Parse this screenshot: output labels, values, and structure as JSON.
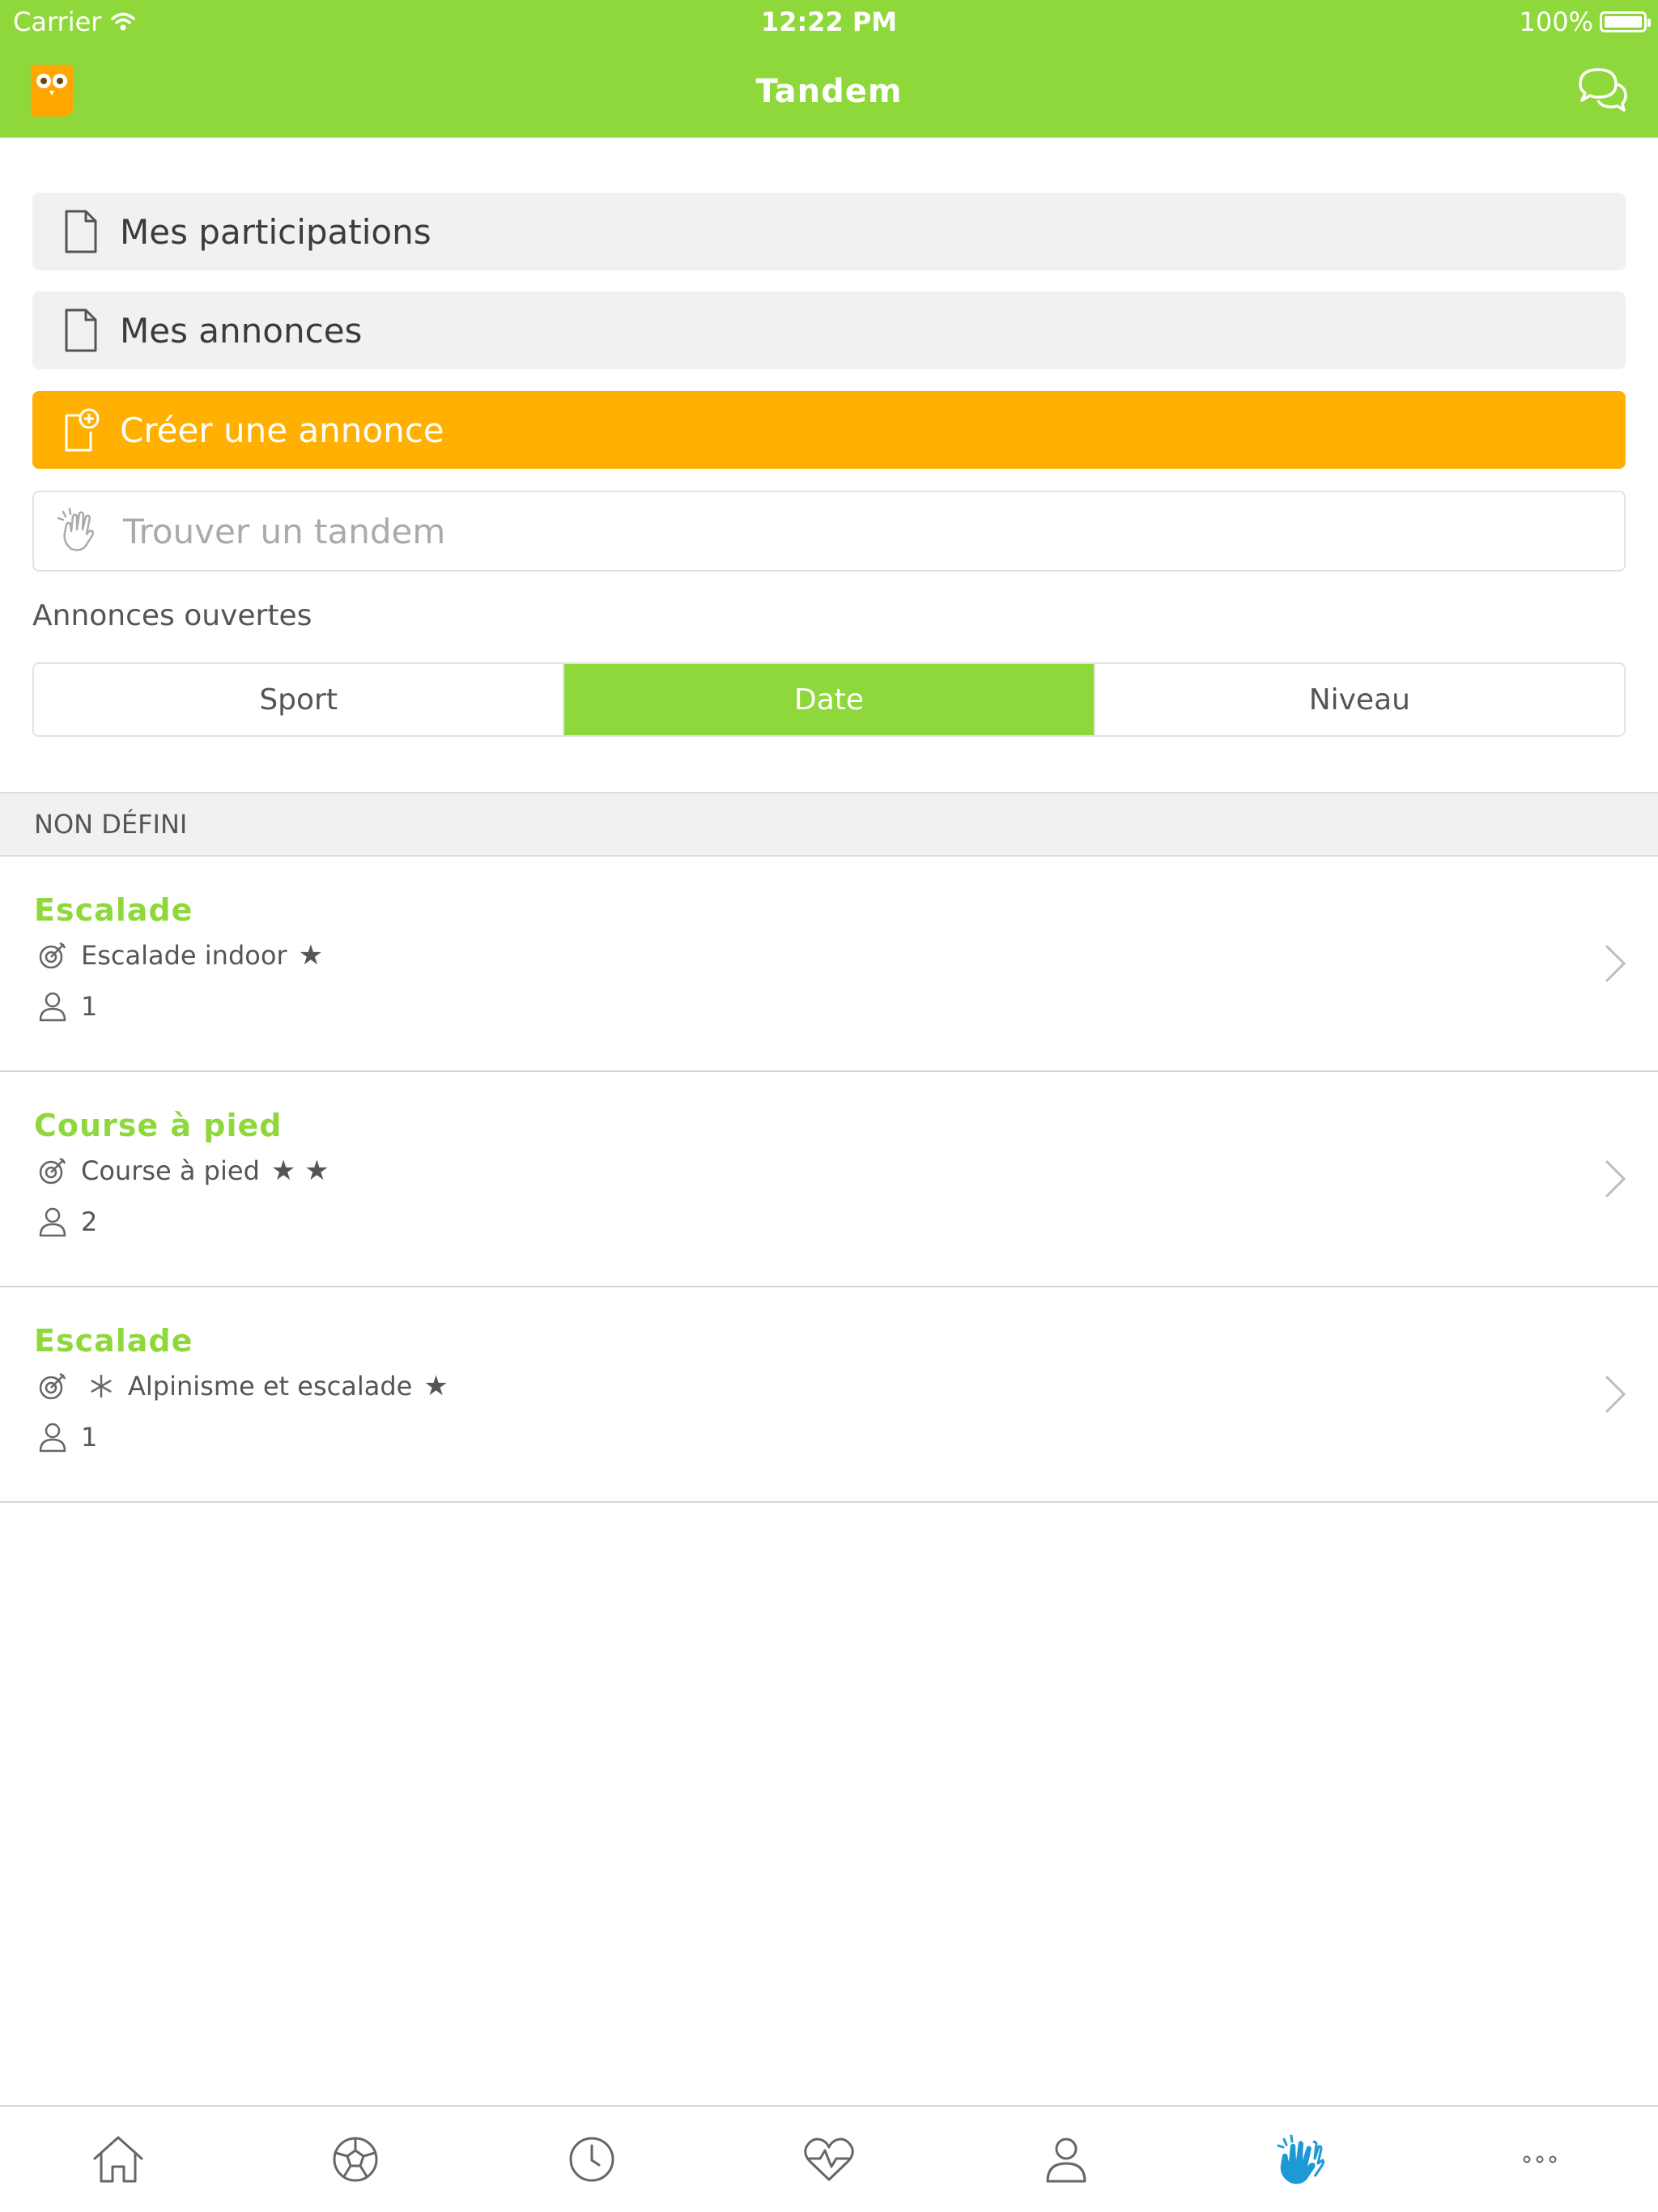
{
  "status_bar": {
    "carrier": "Carrier",
    "time": "12:22 PM",
    "battery": "100%"
  },
  "nav": {
    "title": "Tandem",
    "logo_icon": "owl-logo-icon",
    "chat_icon": "chat-bubbles-icon"
  },
  "menu": {
    "participations": "Mes participations",
    "annonces": "Mes annonces",
    "create": "Créer une annonce"
  },
  "search": {
    "placeholder": "Trouver un tandem",
    "value": ""
  },
  "open_label": "Annonces ouvertes",
  "segments": [
    "Sport",
    "Date",
    "Niveau"
  ],
  "segment_selected": "Date",
  "group_header": "NON DÉFINI",
  "listings": [
    {
      "name": "Escalade",
      "detail": "Escalade indoor",
      "stars": "★",
      "count": "1",
      "snow": false
    },
    {
      "name": "Course à pied",
      "detail": "Course à pied",
      "stars": "★ ★",
      "count": "2",
      "snow": false
    },
    {
      "name": "Escalade",
      "detail": "Alpinisme et escalade",
      "stars": "★",
      "count": "1",
      "snow": true
    }
  ],
  "tabs": [
    "home-icon",
    "soccer-ball-icon",
    "clock-icon",
    "heartbeat-icon",
    "profile-icon",
    "high-five-icon",
    "more-icon"
  ],
  "active_tab": "high-five-icon",
  "colors": {
    "green": "#8fd83b",
    "orange": "#ffb000",
    "active_tab": "#1d9ad6"
  }
}
